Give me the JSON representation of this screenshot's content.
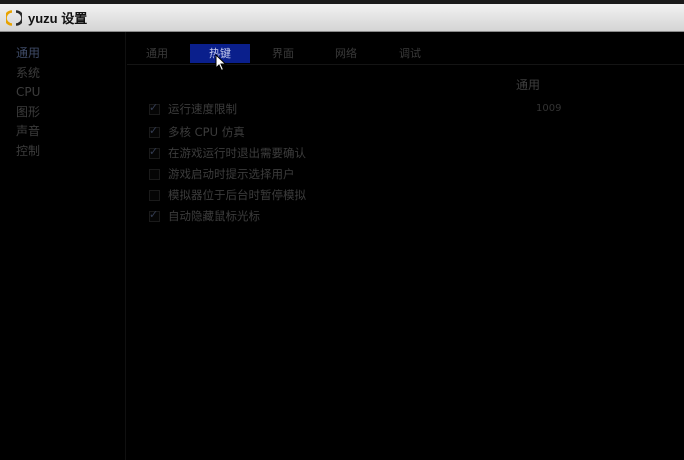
{
  "window": {
    "title": "yuzu 设置",
    "logo_icon": "yuzu-logo-icon"
  },
  "sidebar": {
    "items": [
      {
        "label": "通用",
        "active": true
      },
      {
        "label": "系统",
        "active": false
      },
      {
        "label": "CPU",
        "active": false
      },
      {
        "label": "图形",
        "active": false
      },
      {
        "label": "声音",
        "active": false
      },
      {
        "label": "控制",
        "active": false
      }
    ]
  },
  "tabs": [
    {
      "label": "通用",
      "active": false
    },
    {
      "label": "热键",
      "active": true
    },
    {
      "label": "界面",
      "active": false
    },
    {
      "label": "网络",
      "active": false
    },
    {
      "label": "调试",
      "active": false
    }
  ],
  "group": {
    "title": "通用",
    "speed_limit_value": "1009"
  },
  "options": [
    {
      "label": "运行速度限制",
      "checked": true
    },
    {
      "label": "多核 CPU 仿真",
      "checked": true
    },
    {
      "label": "在游戏运行时退出需要确认",
      "checked": true
    },
    {
      "label": "游戏启动时提示选择用户",
      "checked": false
    },
    {
      "label": "模拟器位于后台时暂停模拟",
      "checked": false
    },
    {
      "label": "自动隐藏鼠标光标",
      "checked": true
    }
  ],
  "colors": {
    "active_tab": "#0a1f8c",
    "background": "#000000",
    "title_bar": "#e6e6e6"
  },
  "icons": {
    "check": "check-mark-icon",
    "cursor": "mouse-pointer-icon"
  }
}
